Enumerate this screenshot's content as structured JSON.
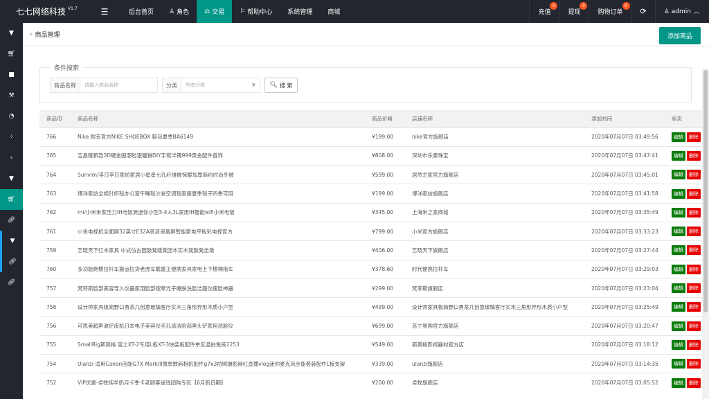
{
  "app": {
    "name": "七七网络科技",
    "version": "V1.7"
  },
  "top_nav": [
    {
      "label": "后台首页",
      "icon": ""
    },
    {
      "label": "角色",
      "icon": "person-icon"
    },
    {
      "label": "交易",
      "icon": "scale-icon",
      "active": true
    },
    {
      "label": "帮助中心",
      "icon": "flag-icon"
    },
    {
      "label": "系统管理",
      "icon": ""
    },
    {
      "label": "商城",
      "icon": ""
    }
  ],
  "top_right": [
    {
      "label": "充值",
      "badge": "0"
    },
    {
      "label": "提现",
      "badge": "0"
    },
    {
      "label": "购物订单",
      "badge": "0"
    }
  ],
  "user": {
    "name": "admin"
  },
  "sidebar_icons": [
    "caret-down-icon",
    "cart-icon",
    "chat-icon",
    "gavel-icon",
    "gauge-icon",
    "spinner-icon",
    "chevron-left-icon",
    "caret-down-icon",
    "cart-icon",
    "link-icon",
    "caret-down-icon",
    "link-icon",
    "link-icon"
  ],
  "page": {
    "title": "商品管理",
    "add_button": "添加商品"
  },
  "search": {
    "legend": "条件搜索",
    "name_label": "商品名称",
    "name_placeholder": "请输入商品名称",
    "category_label": "分类",
    "category_value": "所有分类",
    "button": "搜 索"
  },
  "table": {
    "headers": [
      "商品ID",
      "商品名称",
      "商品价格",
      "店铺名称",
      "添加时间",
      "状态"
    ],
    "edit_label": "编辑",
    "delete_label": "删除",
    "rows": [
      {
        "id": "766",
        "name": "Nike 耐克官方NIKE SHOEBOX 鞋包夏季BA6149",
        "price": "¥199.00",
        "shop": "nike官方旗舰店",
        "time": "2020年07月07日 03:49:56"
      },
      {
        "id": "765",
        "name": "宝昌隆新款3D硬金国潮毡银貔貅DIY手链半镯999黄金配件首饰",
        "price": "¥808.00",
        "shop": "深圳市乐泰珠宝",
        "time": "2020年07月07日 03:47:41"
      },
      {
        "id": "764",
        "name": "Sunvim/孚日孚日家纺家居小星星七孔纤维被保暖加厚简约时尚冬被",
        "price": "¥599.00",
        "shop": "居然之家官方旗舰店",
        "time": "2020年07月07日 03:45:01"
      },
      {
        "id": "763",
        "name": "博洋家纺全棉针织毯办公室午睡毯沙发空调毯家居夏季毯子四季可用",
        "price": "¥199.00",
        "shop": "博洋家纺旗舰店",
        "time": "2020年07月07日 03:41:58"
      },
      {
        "id": "762",
        "name": "mi/小米米家压力IH电饭煲迷你小型3-4人3L家用IH智能wifi小米电饭",
        "price": "¥345.00",
        "shop": "上海米之家商城",
        "time": "2020年07月07日 03:35:49"
      },
      {
        "id": "761",
        "name": "小米电视机全面屏32英寸E32A高清液晶屏智能家电平板彩电视官方",
        "price": "¥799.00",
        "shop": "小米官方旗舰店",
        "time": "2020年07月07日 03:33:23"
      },
      {
        "id": "759",
        "name": "艺晓天下红木家具 中式仿古圆鼓凳矮凳团木实木凳鼓凳坐墩",
        "price": "¥406.00",
        "shop": "艺晓天下旗舰店",
        "time": "2020年07月07日 03:27:44"
      },
      {
        "id": "760",
        "name": "多功能爬楼拉杆车搬运拉货老虎车载重王便携家具家电上下楼梯拖车",
        "price": "¥378.60",
        "shop": "时代便携拉杆车",
        "time": "2020年07月07日 03:29:03"
      },
      {
        "id": "757",
        "name": "梵菲斯脸部美容导入仪器家用脸部按摩光子嫩肤洗脸洁面仪瘦脸神器",
        "price": "¥299.00",
        "shop": "梵菲斯旗舰店",
        "time": "2020年07月07日 03:23:04"
      },
      {
        "id": "758",
        "name": "设计师家具极简野口勇茶几创意玻璃客厅实木三角形异形木质小户型",
        "price": "¥499.00",
        "shop": "设计师家具极简野口勇茶几创意玻璃客厅实木三角形异形木质小户型",
        "time": "2020年07月07日 03:25:49"
      },
      {
        "id": "756",
        "name": "可思美超声波铲皮机日本电子美容仪毛孔清洁脸部黑头铲家用洗脸仪",
        "price": "¥699.00",
        "shop": "苏宁易购官方旗舰店",
        "time": "2020年07月07日 03:20:47"
      },
      {
        "id": "755",
        "name": "SmallRig斯莫格 富士XT-2专用L板XT-3快装板配件单反竖拍兔笼2253",
        "price": "¥549.00",
        "shop": "斯莫格影视器材官方店",
        "time": "2020年07月07日 03:18:12"
      },
      {
        "id": "754",
        "name": "Ulanzi 适用Canon佳能G7X MarkIII微单数码相机配件g7x3拍照摄影网红直播vlog迷你麦克风全能套装配件L板支架",
        "price": "¥339.00",
        "shop": "ulanzi旗舰店",
        "time": "2020年07月07日 03:14:35"
      },
      {
        "id": "752",
        "name": "VIP优惠-卓牧纯羊奶月卡季卡老顾客省钱团购专区【6月新日期】",
        "price": "¥200.00",
        "shop": "卓牧旗舰店",
        "time": "2020年07月07日 03:05:52"
      }
    ]
  }
}
